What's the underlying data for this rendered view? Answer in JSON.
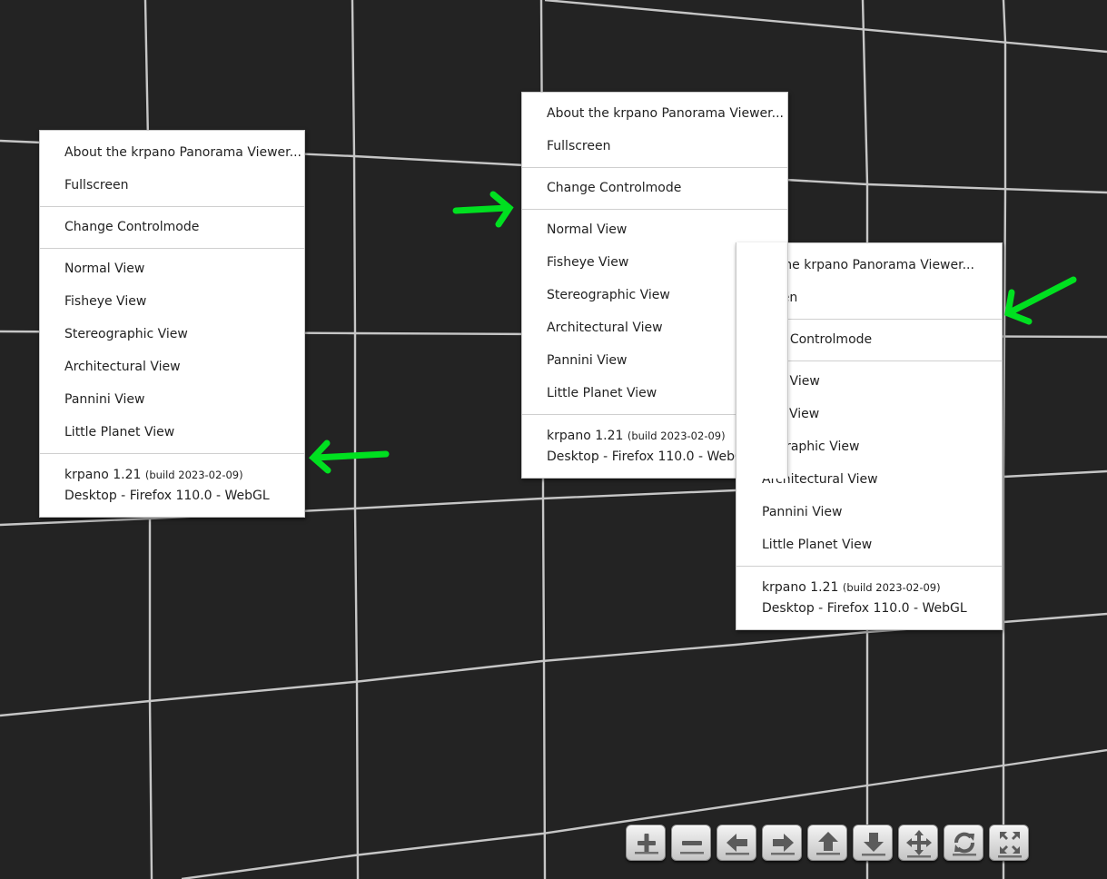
{
  "menu": {
    "about": "About the krpano Panorama Viewer...",
    "fullscreen": "Fullscreen",
    "change_controlmode": "Change Controlmode",
    "views": [
      "Normal View",
      "Fisheye View",
      "Stereographic View",
      "Architectural View",
      "Pannini View",
      "Little Planet View"
    ],
    "version": "krpano 1.21",
    "build": "(build 2023-02-09)",
    "platform": "Desktop - Firefox 110.0 - WebGL"
  },
  "menu3": {
    "about": "ut the krpano Panorama Viewer...",
    "fullscreen": "creen",
    "change_controlmode": "nge Controlmode",
    "views": [
      "mal View",
      "eye View",
      "eographic View",
      "Architectural View",
      "Pannini View",
      "Little Planet View"
    ]
  },
  "toolbar_icons": [
    "zoom-in-icon",
    "zoom-out-icon",
    "arrow-left-icon",
    "arrow-right-icon",
    "arrow-up-icon",
    "arrow-down-icon",
    "move-icon",
    "autorotate-icon",
    "fullscreen-icon"
  ],
  "colors": {
    "background": "#232323",
    "grid": "#d8d8d8",
    "arrow": "#00e020",
    "menu_bg": "#ffffff"
  }
}
